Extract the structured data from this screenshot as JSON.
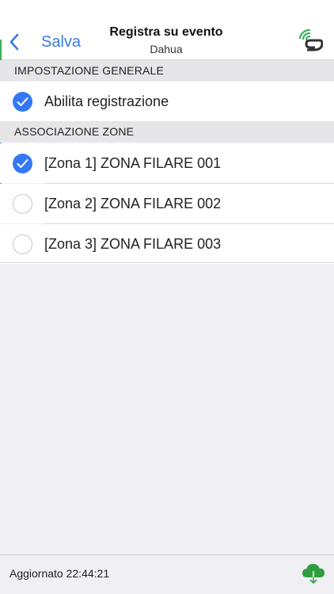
{
  "navbar": {
    "back_label": "Salva",
    "title": "Registra su evento",
    "subtitle": "Dahua"
  },
  "sections": {
    "general": {
      "header": "IMPOSTAZIONE GENERALE",
      "rows": [
        {
          "label": "Abilita registrazione",
          "checked": true
        }
      ]
    },
    "zones": {
      "header": "ASSOCIAZIONE ZONE",
      "rows": [
        {
          "label": "[Zona 1] ZONA FILARE 001",
          "checked": true
        },
        {
          "label": "[Zona 2] ZONA FILARE 002",
          "checked": false
        },
        {
          "label": "[Zona 3] ZONA FILARE 003",
          "checked": false
        }
      ]
    }
  },
  "footer": {
    "status": "Aggiornato 22:44:21"
  },
  "colors": {
    "accent": "#3478f6",
    "accent_green": "#3cae5a",
    "cloud_green": "#2e9e3e"
  },
  "icons": {
    "back": "chevron-left-icon",
    "logo": "wireless-signal-logo",
    "checked": "checkmark-circle-icon",
    "unchecked": "empty-circle-icon",
    "cloud": "cloud-download-icon"
  }
}
